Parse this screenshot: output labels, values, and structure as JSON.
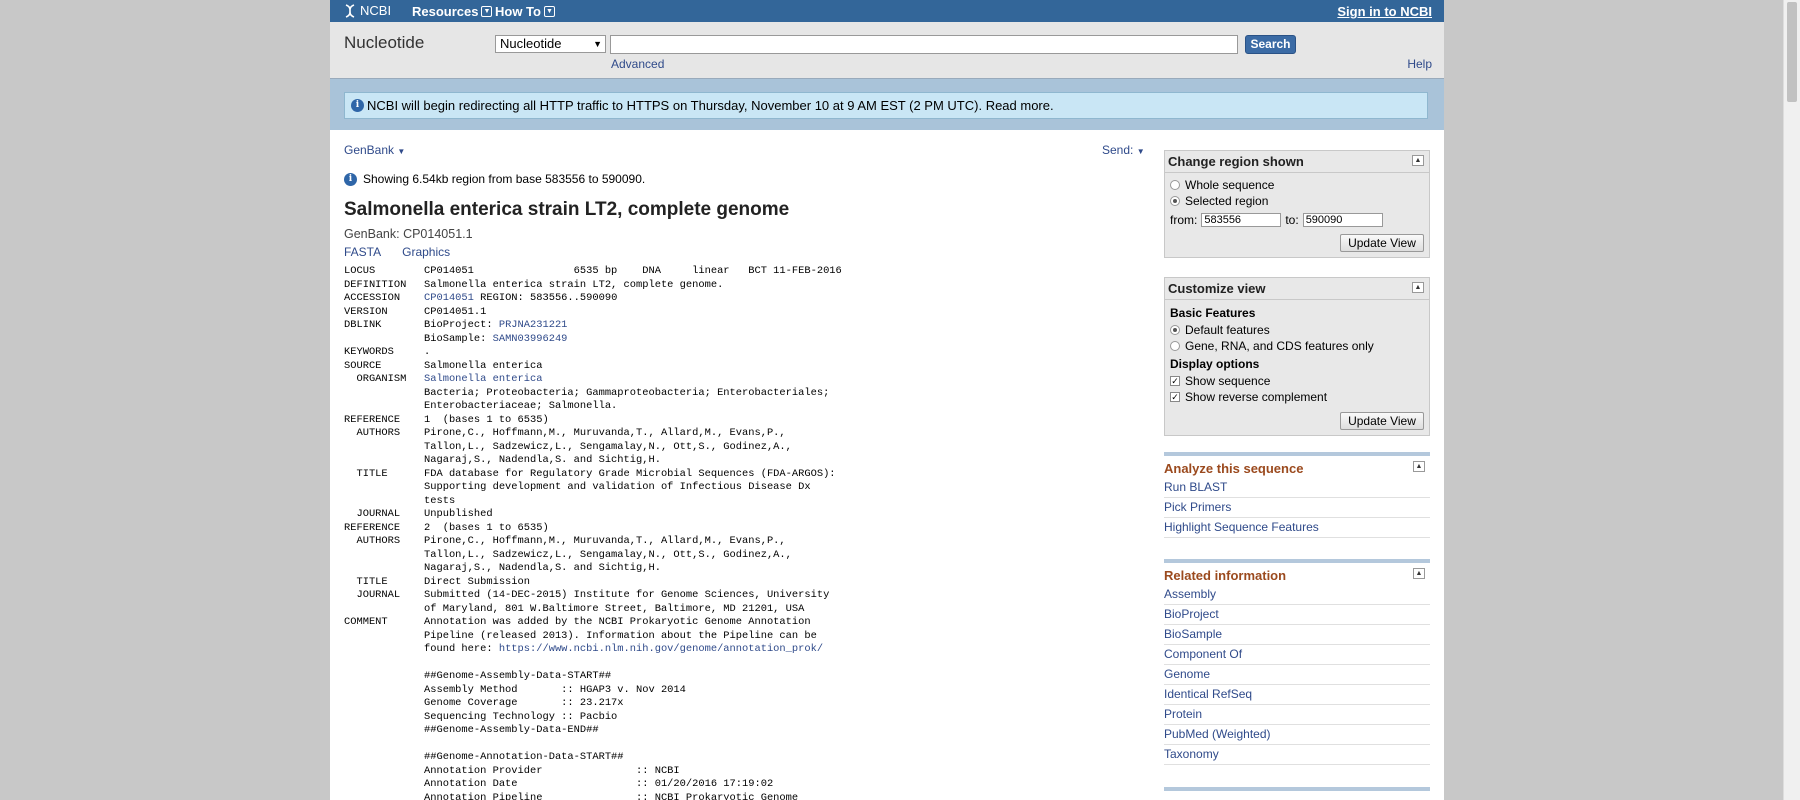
{
  "topbar": {
    "logo": "NCBI",
    "menu1": "Resources",
    "menu2": "How To",
    "signin": "Sign in to NCBI"
  },
  "search": {
    "db_title": "Nucleotide",
    "db_select": "Nucleotide",
    "search_value": "",
    "search_button": "Search",
    "advanced": "Advanced",
    "help": "Help"
  },
  "banner": {
    "text": "NCBI will begin redirecting all HTTP traffic to HTTPS on Thursday, November 10 at 9 AM EST (2 PM UTC).",
    "link": "Read more."
  },
  "record": {
    "format": "GenBank",
    "send": "Send:",
    "showing": "Showing 6.54kb region from base 583556 to 590090.",
    "title": "Salmonella enterica strain LT2, complete genome",
    "accession_line": "GenBank: CP014051.1",
    "link_fasta": "FASTA",
    "link_graphics": "Graphics",
    "lines": [
      {
        "k": "LOCUS",
        "v": "CP014051                6535 bp    DNA     linear   BCT 11-FEB-2016"
      },
      {
        "k": "DEFINITION",
        "v": "Salmonella enterica strain LT2, complete genome."
      },
      {
        "k": "ACCESSION",
        "link": "CP014051",
        "v": " REGION: 583556..590090"
      },
      {
        "k": "VERSION",
        "v": "CP014051.1"
      },
      {
        "k": "DBLINK",
        "v": "BioProject: ",
        "link": "PRJNA231221",
        "prefix": true
      },
      {
        "k": "",
        "v": "BioSample: ",
        "link": "SAMN03996249",
        "prefix": true
      },
      {
        "k": "KEYWORDS",
        "v": "."
      },
      {
        "k": "SOURCE",
        "v": "Salmonella enterica"
      },
      {
        "k": "  ORGANISM",
        "link": "Salmonella enterica",
        "v": ""
      },
      {
        "k": "",
        "v": "Bacteria; Proteobacteria; Gammaproteobacteria; Enterobacteriales;"
      },
      {
        "k": "",
        "v": "Enterobacteriaceae; Salmonella."
      },
      {
        "k": "REFERENCE",
        "v": "1  (bases 1 to 6535)"
      },
      {
        "k": "  AUTHORS",
        "v": "Pirone,C., Hoffmann,M., Muruvanda,T., Allard,M., Evans,P.,"
      },
      {
        "k": "",
        "v": "Tallon,L., Sadzewicz,L., Sengamalay,N., Ott,S., Godinez,A.,"
      },
      {
        "k": "",
        "v": "Nagaraj,S., Nadendla,S. and Sichtig,H."
      },
      {
        "k": "  TITLE",
        "v": "FDA database for Regulatory Grade Microbial Sequences (FDA-ARGOS):"
      },
      {
        "k": "",
        "v": "Supporting development and validation of Infectious Disease Dx"
      },
      {
        "k": "",
        "v": "tests"
      },
      {
        "k": "  JOURNAL",
        "v": "Unpublished"
      },
      {
        "k": "REFERENCE",
        "v": "2  (bases 1 to 6535)"
      },
      {
        "k": "  AUTHORS",
        "v": "Pirone,C., Hoffmann,M., Muruvanda,T., Allard,M., Evans,P.,"
      },
      {
        "k": "",
        "v": "Tallon,L., Sadzewicz,L., Sengamalay,N., Ott,S., Godinez,A.,"
      },
      {
        "k": "",
        "v": "Nagaraj,S., Nadendla,S. and Sichtig,H."
      },
      {
        "k": "  TITLE",
        "v": "Direct Submission"
      },
      {
        "k": "  JOURNAL",
        "v": "Submitted (14-DEC-2015) Institute for Genome Sciences, University"
      },
      {
        "k": "",
        "v": "of Maryland, 801 W.Baltimore Street, Baltimore, MD 21201, USA"
      },
      {
        "k": "COMMENT",
        "v": "Annotation was added by the NCBI Prokaryotic Genome Annotation"
      },
      {
        "k": "",
        "v": "Pipeline (released 2013). Information about the Pipeline can be"
      },
      {
        "k": "",
        "v": "found here: ",
        "link": "https://www.ncbi.nlm.nih.gov/genome/annotation_prok/",
        "prefix": true
      },
      {
        "k": "",
        "v": ""
      },
      {
        "k": "",
        "v": "##Genome-Assembly-Data-START##"
      },
      {
        "k": "",
        "v": "Assembly Method       :: HGAP3 v. Nov 2014"
      },
      {
        "k": "",
        "v": "Genome Coverage       :: 23.217x"
      },
      {
        "k": "",
        "v": "Sequencing Technology :: Pacbio"
      },
      {
        "k": "",
        "v": "##Genome-Assembly-Data-END##"
      },
      {
        "k": "",
        "v": ""
      },
      {
        "k": "",
        "v": "##Genome-Annotation-Data-START##"
      },
      {
        "k": "",
        "v": "Annotation Provider               :: NCBI"
      },
      {
        "k": "",
        "v": "Annotation Date                   :: 01/20/2016 17:19:02"
      },
      {
        "k": "",
        "v": "Annotation Pipeline               :: NCBI Prokaryotic Genome"
      }
    ]
  },
  "region": {
    "header": "Change region shown",
    "opt_whole": "Whole sequence",
    "opt_selected": "Selected region",
    "from_label": "from:",
    "from_value": "583556",
    "to_label": "to:",
    "to_value": "590090",
    "button": "Update View"
  },
  "customize": {
    "header": "Customize view",
    "basic_heading": "Basic Features",
    "opt_default": "Default features",
    "opt_gene": "Gene, RNA, and CDS features only",
    "display_heading": "Display options",
    "chk_seq": "Show sequence",
    "chk_rev": "Show reverse complement",
    "button": "Update View"
  },
  "analyze": {
    "header": "Analyze this sequence",
    "items": [
      "Run BLAST",
      "Pick Primers",
      "Highlight Sequence Features"
    ]
  },
  "related": {
    "header": "Related information",
    "items": [
      "Assembly",
      "BioProject",
      "BioSample",
      "Component Of",
      "Genome",
      "Identical RefSeq",
      "Protein",
      "PubMed (Weighted)",
      "Taxonomy"
    ]
  }
}
